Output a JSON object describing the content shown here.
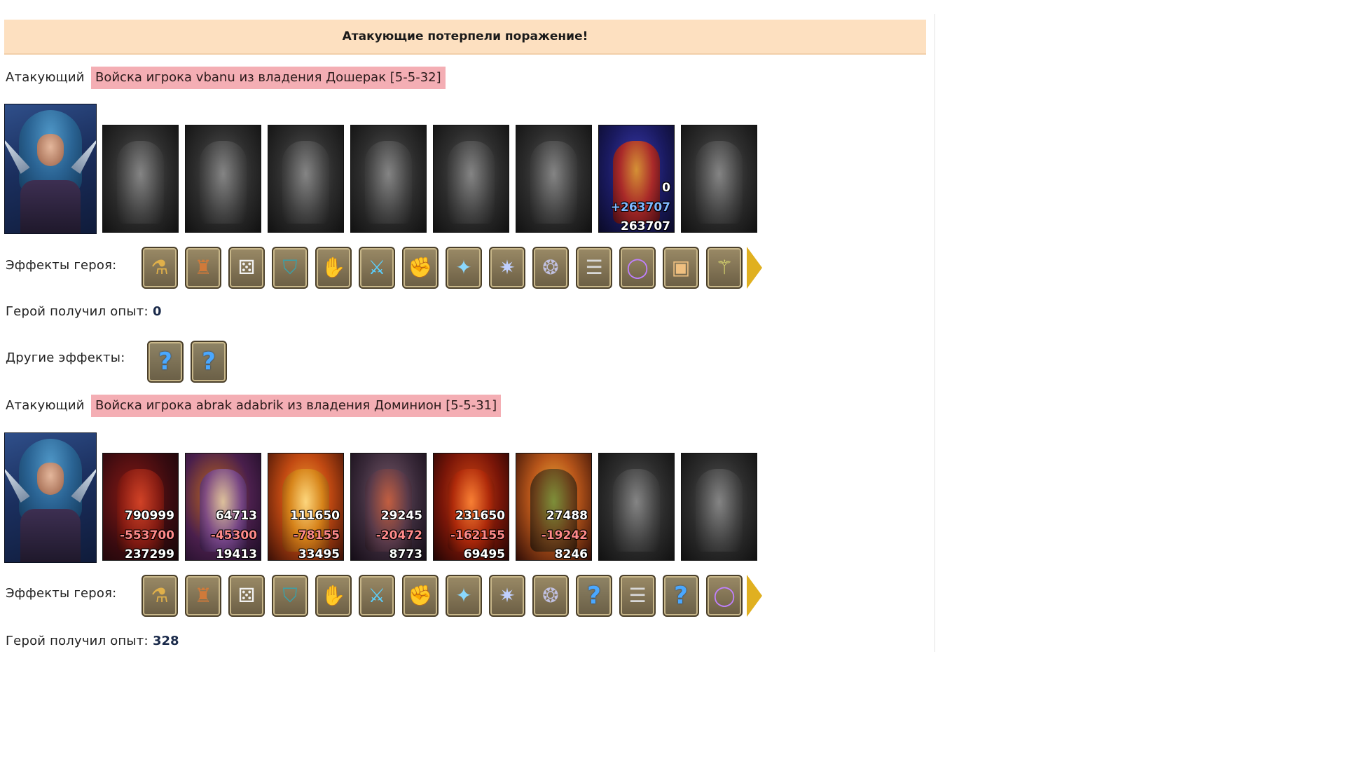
{
  "result_banner": "Атакующие потерпели поражение!",
  "sides": [
    {
      "role_label": "Атакующий",
      "army_label": "Войска игрока vbanu из владения Дошерак [5-5-32]",
      "units": [
        {
          "icon": "dragon-unit-icon",
          "style": "grey"
        },
        {
          "icon": "skeleton-unit-icon",
          "style": "grey"
        },
        {
          "icon": "hound-unit-icon",
          "style": "grey"
        },
        {
          "icon": "wyvern-unit-icon",
          "style": "grey"
        },
        {
          "icon": "golem-unit-icon",
          "style": "grey"
        },
        {
          "icon": "knight-unit-icon",
          "style": "grey"
        },
        {
          "icon": "queen-unit-icon",
          "style": "c-queen",
          "stats": [
            "0",
            "+263707",
            "263707"
          ]
        },
        {
          "icon": "wraith-unit-icon",
          "style": "grey"
        }
      ],
      "hero_effects_label": "Эффекты героя:",
      "hero_effects": [
        "potion-icon",
        "fortress-icon",
        "dice-icon",
        "shield-icon",
        "shield-hand-icon",
        "sword-icon",
        "sword-hand-icon",
        "crystal-hand-icon",
        "claw-icon",
        "amulet-icon",
        "scroll-icon",
        "ring-icon",
        "chest-icon",
        "staff-icon"
      ],
      "exp_label": "Герой получил опыт:",
      "exp_value": "0",
      "other_effects_label": "Другие эффекты:",
      "other_effects": [
        "?",
        "?"
      ]
    },
    {
      "role_label": "Атакующий",
      "army_label": "Войска игрока abrak adabrik из владения Доминион [5-5-31]",
      "units": [
        {
          "icon": "red-dragon-unit-icon",
          "style": "c-red",
          "stats": [
            "790999",
            "-553700",
            "237299"
          ]
        },
        {
          "icon": "lich-unit-icon",
          "style": "c-purple",
          "stats": [
            "64713",
            "-45300",
            "19413"
          ]
        },
        {
          "icon": "fire-beast-unit-icon",
          "style": "c-fire",
          "stats": [
            "111650",
            "-78155",
            "33495"
          ]
        },
        {
          "icon": "bone-drake-unit-icon",
          "style": "c-drake",
          "stats": [
            "29245",
            "-20472",
            "8773"
          ]
        },
        {
          "icon": "lava-golem-unit-icon",
          "style": "c-lava",
          "stats": [
            "231650",
            "-162155",
            "69495"
          ]
        },
        {
          "icon": "orc-warlord-unit-icon",
          "style": "c-orc",
          "stats": [
            "27488",
            "-19242",
            "8246"
          ]
        },
        {
          "icon": "dark-knight-unit-icon",
          "style": "grey"
        },
        {
          "icon": "wraith-unit-icon",
          "style": "grey"
        }
      ],
      "hero_effects_label": "Эффекты героя:",
      "hero_effects": [
        "potion-icon",
        "fortress-icon",
        "dice-icon",
        "shield-icon",
        "shield-hand-icon",
        "sword-icon",
        "sword-hand-icon",
        "crystal-hand-icon",
        "claw-icon",
        "amulet-icon",
        "?",
        "scroll-icon",
        "?",
        "ring-icon"
      ],
      "exp_label": "Герой получил опыт:",
      "exp_value": "328"
    }
  ],
  "colors": {
    "banner_bg": "#fde0c0",
    "army_tag_bg": "#f4aeb4",
    "loss_number": "#ff8a8a",
    "gain_number": "#7fb8ff"
  }
}
